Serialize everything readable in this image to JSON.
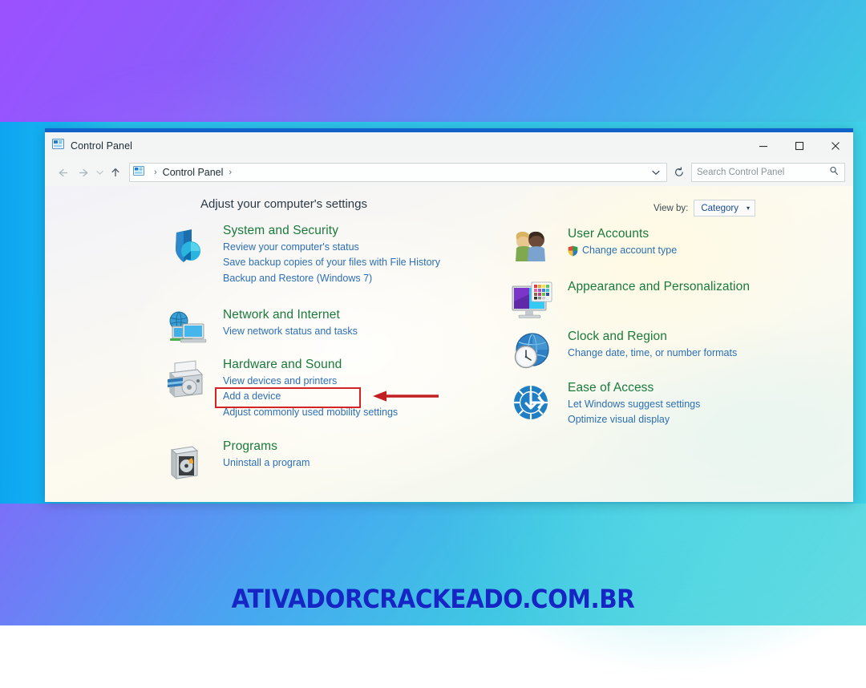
{
  "window": {
    "title": "Control Panel",
    "title_icon": "control-panel-icon",
    "caption": {
      "minimize": "–",
      "maximize": "□",
      "close": "✕"
    }
  },
  "addressbar": {
    "back_icon": "arrow-left-icon",
    "forward_icon": "arrow-right-icon",
    "recent_icon": "chevron-down-icon",
    "up_icon": "arrow-up-icon",
    "breadcrumb_icon": "control-panel-icon",
    "breadcrumb": "Control Panel",
    "separator": "›",
    "dropdown_caret": "⌄",
    "refresh_icon": "refresh-icon",
    "search_placeholder": "Search Control Panel",
    "search_value": "",
    "search_icon": "search-icon"
  },
  "content": {
    "page_title": "Adjust your computer's settings",
    "view_by": {
      "label": "View by:",
      "value": "Category",
      "caret": "▾"
    },
    "left_column": [
      {
        "id": "system-and-security",
        "icon": "shield-icon",
        "title": "System and Security",
        "links": [
          "Review your computer's status",
          "Save backup copies of your files with File History",
          "Backup and Restore (Windows 7)"
        ]
      },
      {
        "id": "network-and-internet",
        "icon": "network-globe-monitor-icon",
        "title": "Network and Internet",
        "links": [
          "View network status and tasks"
        ]
      },
      {
        "id": "hardware-and-sound",
        "icon": "printer-icon",
        "title": "Hardware and Sound",
        "links": [
          "View devices and printers",
          "Add a device",
          "Adjust commonly used mobility settings"
        ]
      },
      {
        "id": "programs",
        "icon": "programs-disc-icon",
        "title": "Programs",
        "links": [
          "Uninstall a program"
        ]
      }
    ],
    "right_column": [
      {
        "id": "user-accounts",
        "icon": "user-accounts-people-icon",
        "title": "User Accounts",
        "links": [
          "Change account type"
        ],
        "link_shield": true
      },
      {
        "id": "appearance-and-personalization",
        "icon": "monitor-palette-icon",
        "title": "Appearance and Personalization",
        "links": []
      },
      {
        "id": "clock-and-region",
        "icon": "clock-globe-icon",
        "title": "Clock and Region",
        "links": [
          "Change date, time, or number formats"
        ]
      },
      {
        "id": "ease-of-access",
        "icon": "ease-of-access-icon",
        "title": "Ease of Access",
        "links": [
          "Let Windows suggest settings",
          "Optimize visual display"
        ]
      }
    ]
  },
  "annotation": {
    "highlight_target": "View devices and printers",
    "highlight_color": "#d42323",
    "arrow_color": "#c22020",
    "arrow_icon": "arrow-left-pointer-icon"
  },
  "watermark": {
    "text": "ATIVADORCRACKEADO.COM.BR",
    "color": "#1526c4"
  },
  "theme": {
    "background_start": "#9b51ff",
    "background_end": "#63dbe2",
    "band_color": "#12b4f2",
    "title_accent": "#0f62c8",
    "category_title_color": "#1a7a3c",
    "link_color": "#2c6fb5"
  }
}
